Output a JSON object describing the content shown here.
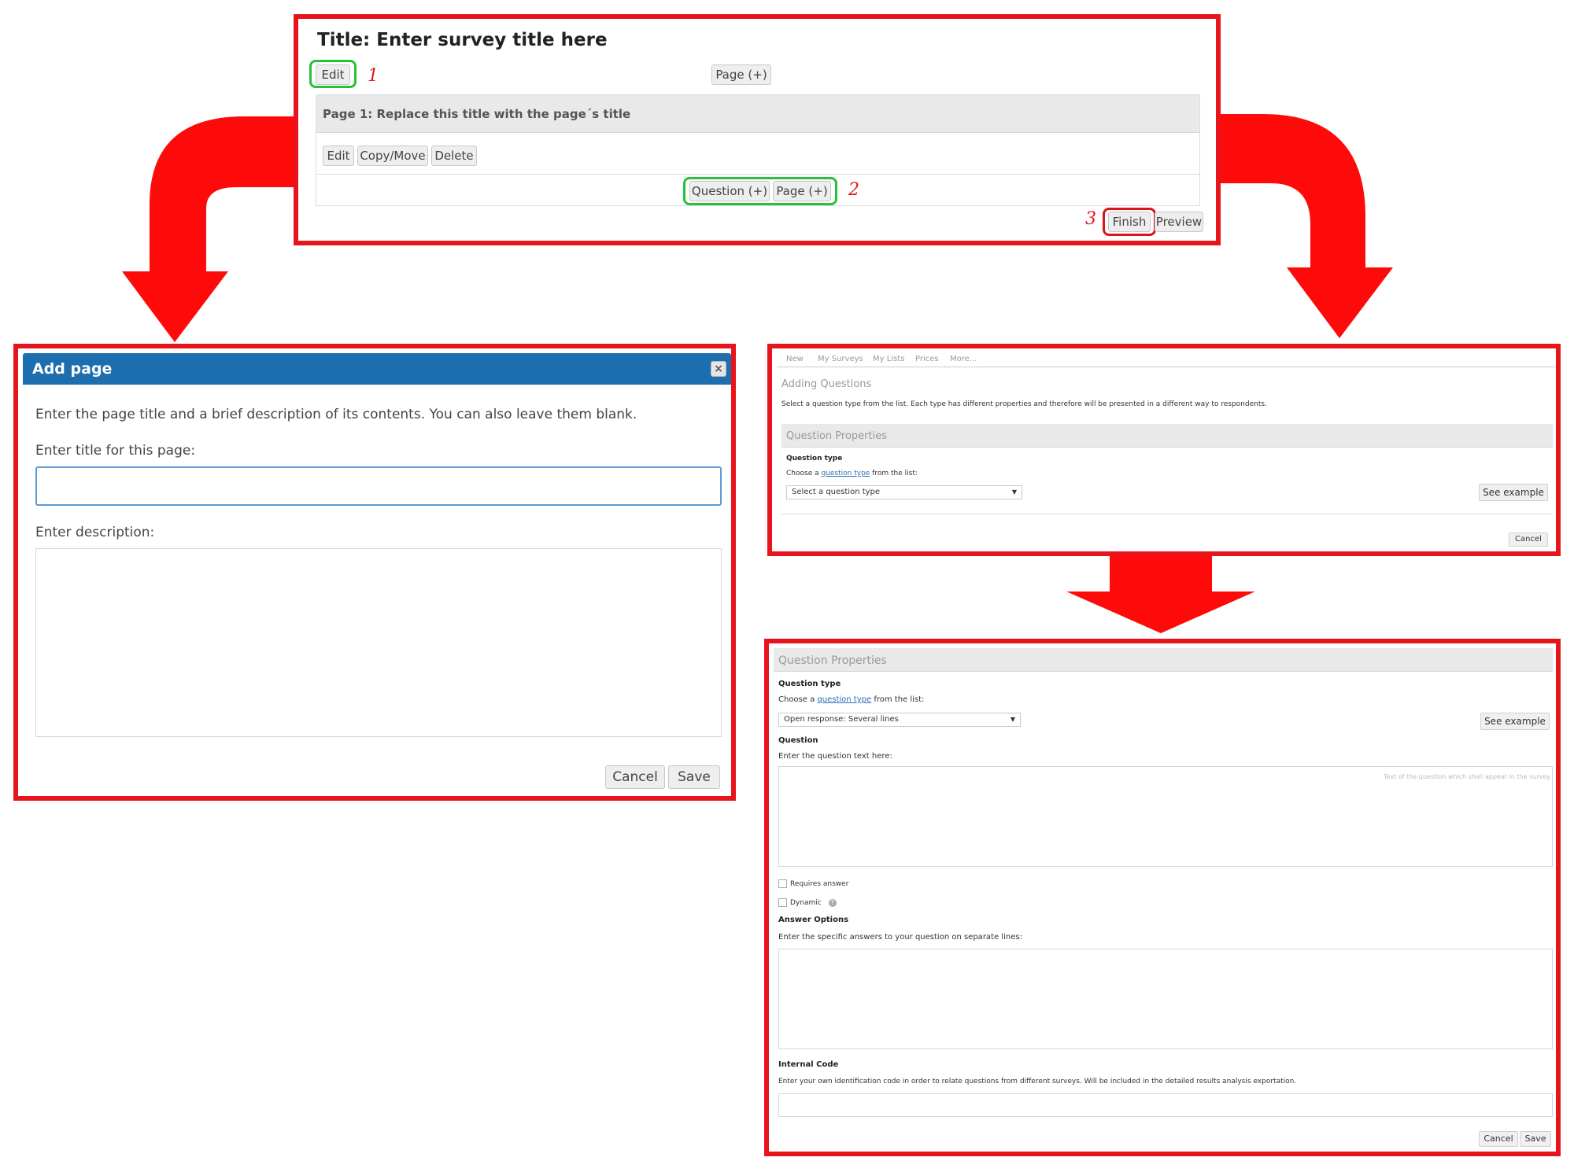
{
  "top_panel": {
    "title": "Title: Enter survey title here",
    "edit_label": "Edit",
    "page_add_label": "Page (+)",
    "page_heading": "Page 1: Replace this title with the page´s title",
    "page_edit_label": "Edit",
    "copy_move_label": "Copy/Move",
    "delete_label": "Delete",
    "question_add_label": "Question (+)",
    "page_add_bottom_label": "Page (+)",
    "finish_label": "Finish",
    "preview_label": "Preview",
    "step_marks": [
      "1",
      "2",
      "3"
    ]
  },
  "add_page_dialog": {
    "header": "Add page",
    "close_icon": "close-icon",
    "instructions": "Enter the page title and a brief description of its contents. You can also leave them blank.",
    "title_label": "Enter title for this page:",
    "title_value": "",
    "description_label": "Enter description:",
    "description_value": "",
    "cancel_label": "Cancel",
    "save_label": "Save"
  },
  "adding_questions_panel": {
    "nav_tabs": [
      "New",
      "My Surveys",
      "My Lists",
      "Prices",
      "More..."
    ],
    "heading": "Adding Questions",
    "description": "Select a question type from the list. Each type has different properties and therefore will be presented in a different way to respondents.",
    "section_title": "Question Properties",
    "question_type_label": "Question type",
    "choose_prefix": "Choose a ",
    "choose_link": "question type",
    "choose_suffix": " from the list:",
    "select_value": "Select a question type",
    "see_example_label": "See example",
    "cancel_label": "Cancel"
  },
  "question_properties_panel": {
    "section_title": "Question Properties",
    "question_type_label": "Question type",
    "choose_prefix": "Choose a ",
    "choose_link": "question type",
    "choose_suffix": " from the list:",
    "select_value": "Open response: Several lines",
    "see_example_label": "See example",
    "question_label": "Question",
    "question_hint": "Enter the question text here:",
    "question_placeholder": "Text of the question which shall appear in the survey",
    "requires_answer_label": "Requires answer",
    "dynamic_label": "Dynamic",
    "answer_options_label": "Answer Options",
    "answer_options_hint": "Enter the specific answers to your question on separate lines:",
    "internal_code_label": "Internal Code",
    "internal_code_hint": "Enter your own identification code in order to relate questions from different surveys. Will be included in the detailed results analysis exportation.",
    "cancel_label": "Cancel",
    "save_label": "Save"
  },
  "colors": {
    "frame_red": "#e8141b",
    "highlight_green": "#27c23a",
    "dialog_header_blue": "#1d6eaf"
  }
}
